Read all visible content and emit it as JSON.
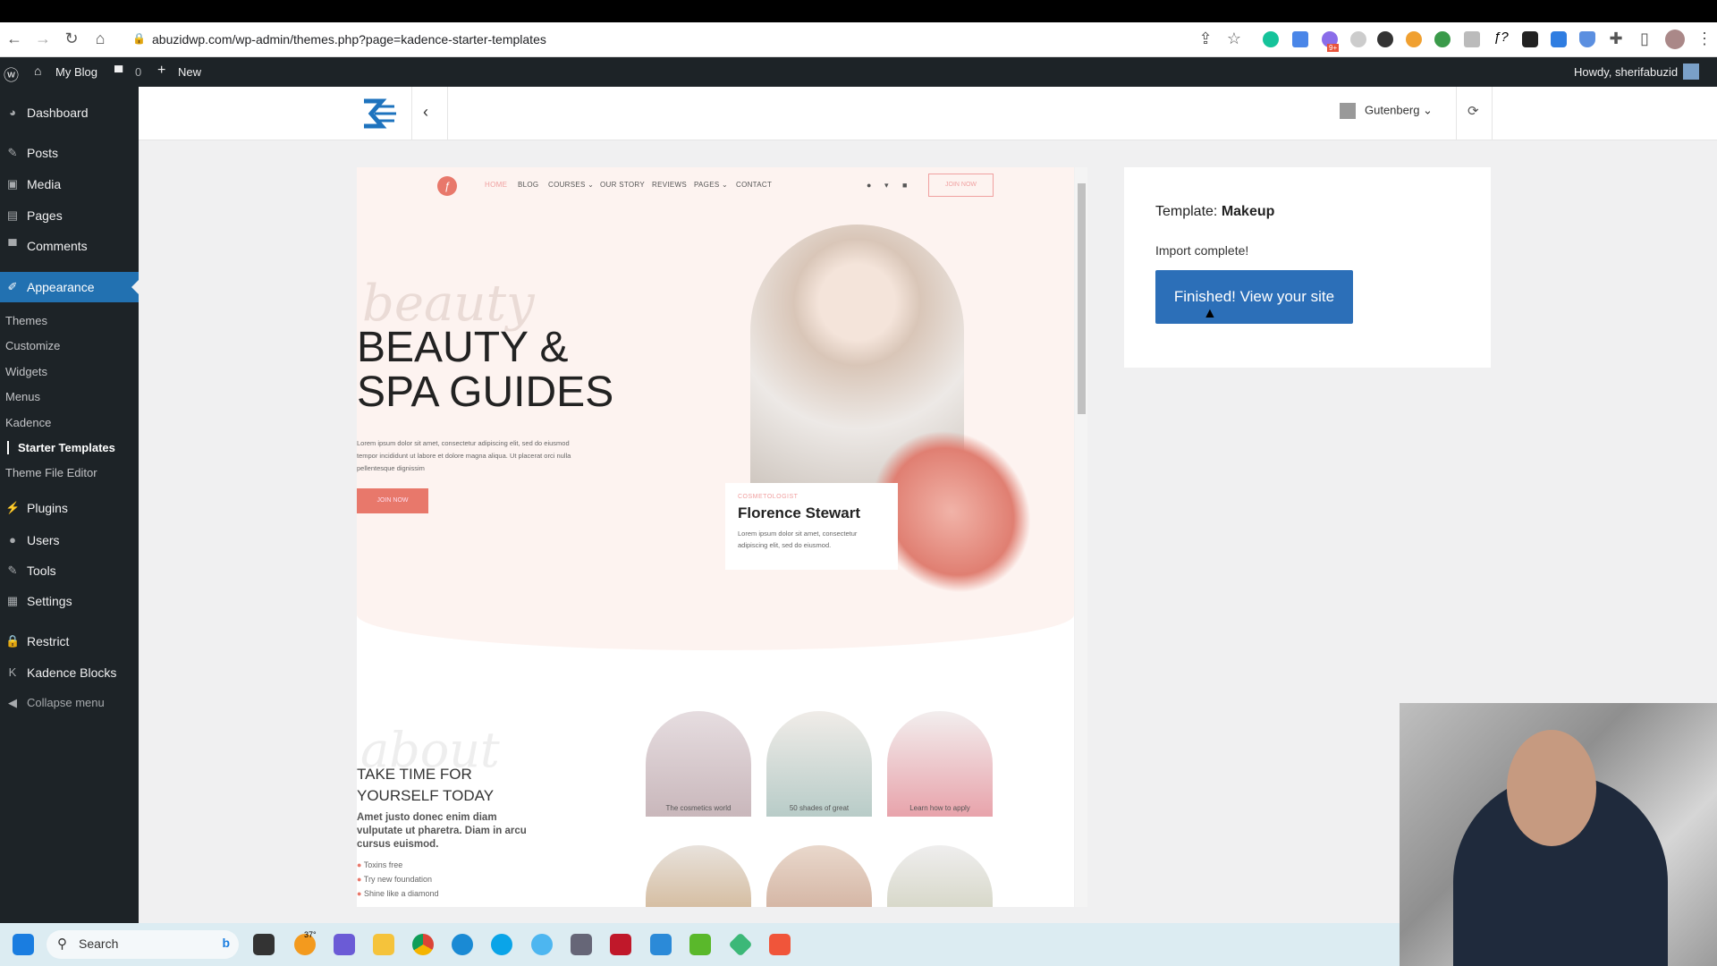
{
  "browser": {
    "url": "abuzidwp.com/wp-admin/themes.php?page=kadence-starter-templates",
    "extension_badge": "9+"
  },
  "adminbar": {
    "site": "My Blog",
    "comments": "0",
    "new": "New",
    "greeting": "Howdy, sherifabuzid"
  },
  "sidebar": {
    "items": [
      "Dashboard",
      "Posts",
      "Media",
      "Pages",
      "Comments",
      "Appearance",
      "Plugins",
      "Users",
      "Tools",
      "Settings",
      "Restrict",
      "Kadence Blocks",
      "Collapse menu"
    ],
    "submenu": [
      "Themes",
      "Customize",
      "Widgets",
      "Menus",
      "Kadence",
      "Starter Templates",
      "Theme File Editor"
    ]
  },
  "header": {
    "builder": "Gutenberg"
  },
  "preview": {
    "nav": [
      "HOME",
      "BLOG",
      "COURSES ⌄",
      "OUR STORY",
      "REVIEWS",
      "PAGES ⌄",
      "CONTACT"
    ],
    "join_top": "JOIN NOW",
    "script_word": "beauty",
    "title_line1": "BEAUTY &",
    "title_line2": "SPA GUIDES",
    "lorem": "Lorem ipsum dolor sit amet, consectetur adipiscing elit, sed do eiusmod tempor incididunt ut labore et dolore magna aliqua. Ut placerat orci nulla pellentesque dignissim",
    "join_btn": "JOIN NOW",
    "card_role": "COSMETOLOGIST",
    "card_name": "Florence Stewart",
    "card_text": "Lorem ipsum dolor sit amet, consectetur adipiscing elit, sed do eiusmod.",
    "about_script": "about",
    "about_title": "TAKE TIME FOR YOURSELF TODAY",
    "about_sub": "Amet justo donec enim diam vulputate ut pharetra. Diam in arcu cursus euismod.",
    "bullets": [
      "Toxins free",
      "Try new foundation",
      "Shine like a diamond"
    ],
    "tiles": [
      "The cosmetics world",
      "50 shades of great",
      "Learn how to apply"
    ]
  },
  "panel": {
    "template_label": "Template:",
    "template_name": "Makeup",
    "status": "Import complete!",
    "button": "Finished! View your site"
  },
  "taskbar": {
    "search": "Search",
    "weather": "37°"
  },
  "colors": {
    "accent": "#2c6fb8",
    "wp_dark": "#1d2327",
    "pink": "#e8786b"
  }
}
